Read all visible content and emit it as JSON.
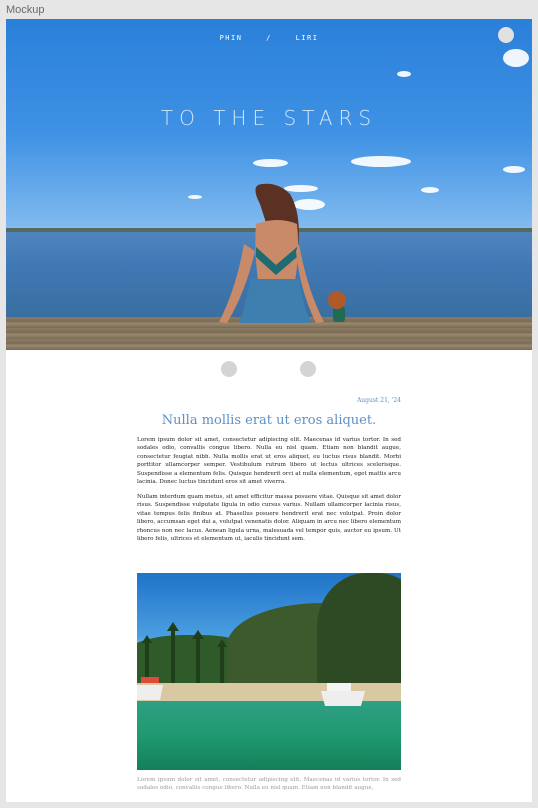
{
  "frame": {
    "label": "Mockup"
  },
  "nav": {
    "items": [
      "PHIN",
      "/",
      "LIRI"
    ]
  },
  "hero": {
    "title": "TO THE STARS",
    "image_subject": "person-sitting-on-dock-by-lake-icon"
  },
  "slider": {
    "dots": 2
  },
  "post": {
    "date": "August 21, '24",
    "title": "Nulla mollis erat ut eros aliquet.",
    "paragraphs": [
      "Lorem ipsum dolor sit amet, consectetur adipiscing elit. Maecenas id varius tortor. In sed sodales odio, convallis congue libero. Nulla eu nisl quam. Etiam non blandit augue, consectetur feugiat nibh. Nulla mollis erat ut eros aliquet, eu luctus risus blandit. Morbi porttitor ullamcorper semper. Vestibulum rutrum libero ut lectus ultrices scelerisque. Suspendisse a elementum felis. Quisque hendrerit orci at nulla elementum, eget mattis arcu lacinia. Donec luctus tincidunt eros sit amet viverra.",
      "Nullam interdum quam metus, sit amet efficitur massa posuere vitae. Quisque sit amet dolor risus. Suspendisse vulputate ligula in odio cursus varius. Nullam ullamcorper lacinia risus, vitae tempus felis finibus at. Phasellus posuere hendrerit erat nec volutpat. Proin dolor libero, accumsan eget dui a, volutpat venenatis dolor. Aliquam in arcu nec libero elementum rhoncus non nec lacus. Aenean ligula urna, malesuada vel tempor quis, auctor eu ipsum. Ut libero felis, ultrices et elementum ut, iaculis tincidunt sem."
    ],
    "photo_subject": "tropical-beach-boats-icon",
    "caption": "Lorem ipsum dolor sit amet, consectetur adipiscing elit. Maecenas id varius tortor. In sed sodales odio, convallis congue libero. Nulla eu nisl quam. Etiam non blandit augue,"
  },
  "colors": {
    "accent": "#5e8fc6",
    "frame_bg": "#e6e6e6",
    "dot": "#d4d4d4"
  }
}
